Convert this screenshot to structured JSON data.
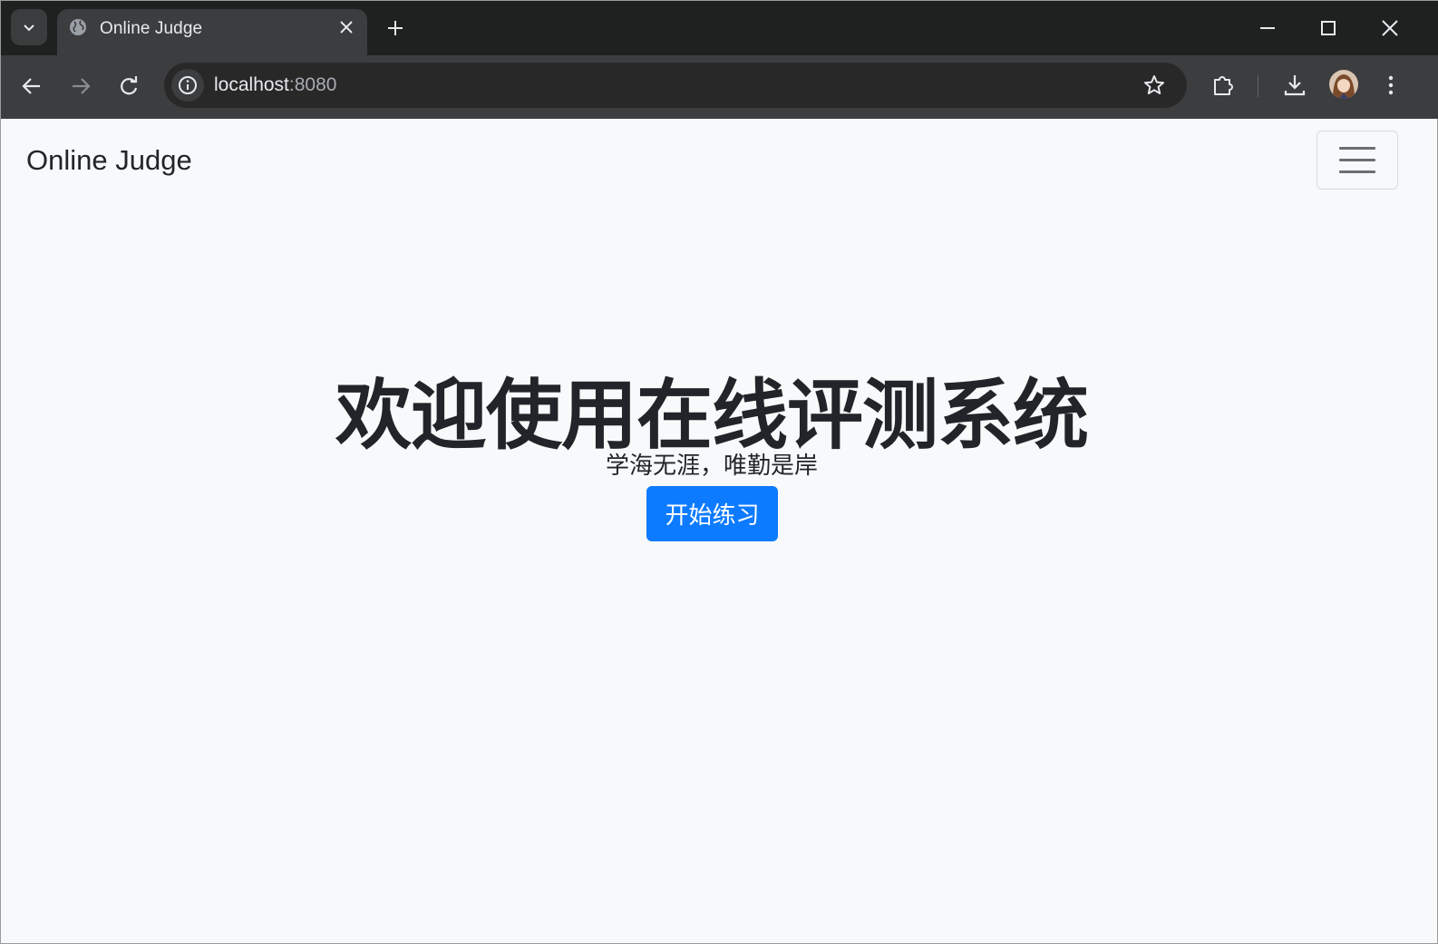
{
  "browser": {
    "tab_title": "Online Judge",
    "url_host": "localhost",
    "url_port": ":8080"
  },
  "navbar": {
    "brand": "Online Judge"
  },
  "hero": {
    "title": "欢迎使用在线评测系统",
    "subtitle": "学海无涯，唯勤是岸",
    "button_label": "开始练习"
  },
  "colors": {
    "primary": "#0d7bff",
    "page_bg": "#f8f9fa",
    "text": "#212529"
  }
}
